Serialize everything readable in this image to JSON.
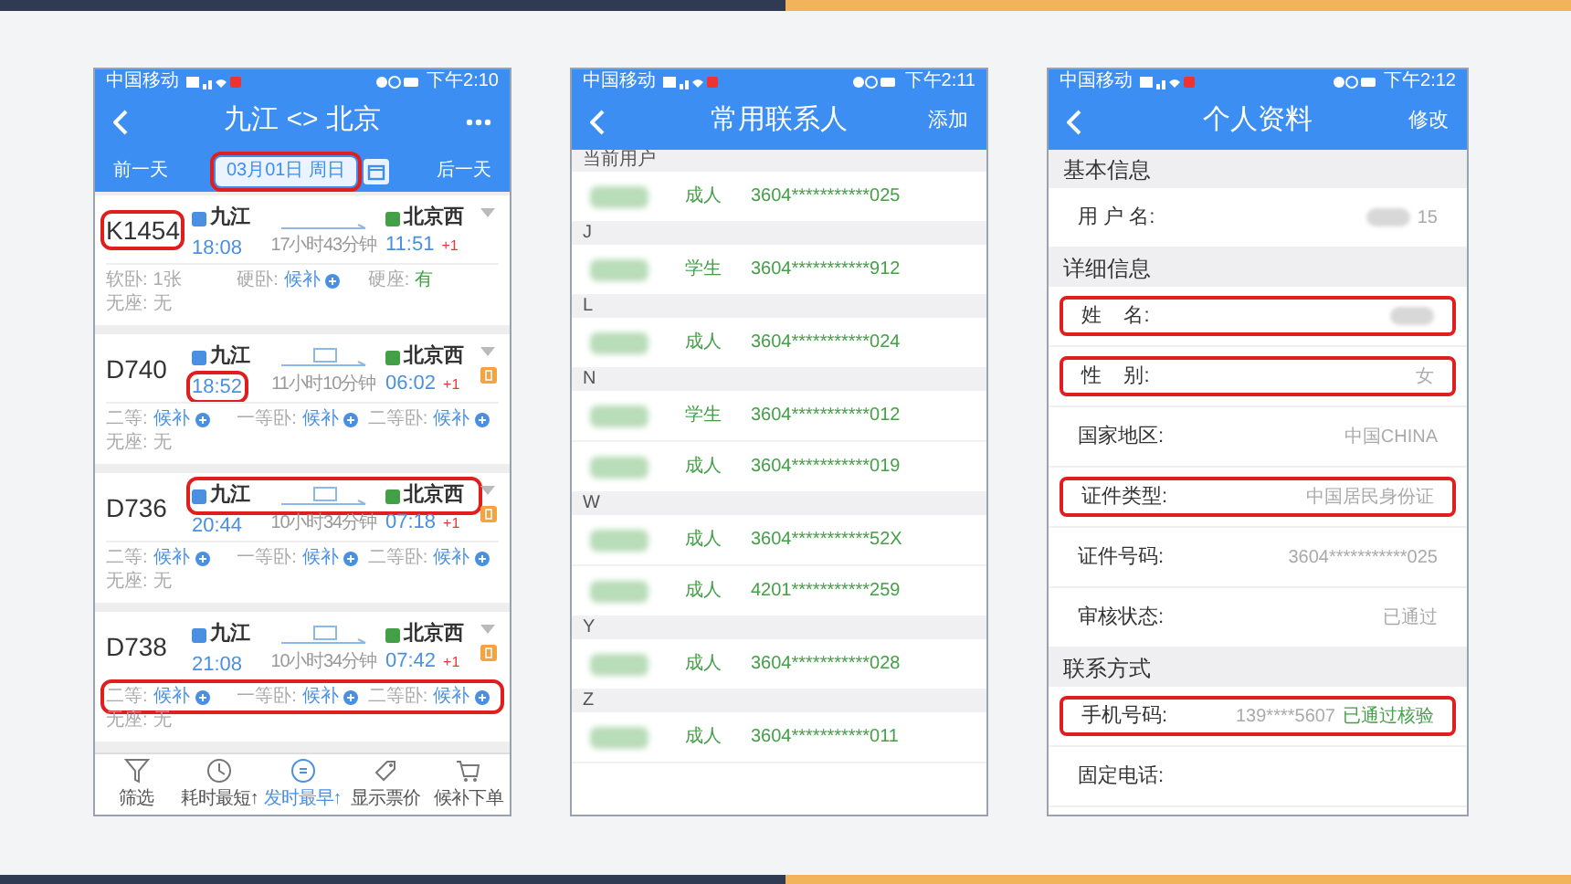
{
  "trains_screen": {
    "status": {
      "carrier": "中国移动",
      "time": "下午2:10"
    },
    "title": "九江 <> 北京",
    "prev_day": "前一天",
    "date": "03月01日 周日",
    "date_highlighted": true,
    "next_day": "后一天",
    "trains": [
      {
        "number": "K1454",
        "from": "九江",
        "depart": "18:08",
        "duration": "17小时43分钟",
        "to": "北京西",
        "arrive": "11:51",
        "arrive_mark": "+1",
        "tagged": false,
        "number_highlighted": true,
        "time_highlighted": false,
        "route_highlighted": false,
        "seats_highlighted": false,
        "seats": [
          [
            {
              "label": "软卧:",
              "value": "1张",
              "kind": "plain"
            },
            {
              "label": "硬卧:",
              "value": "候补",
              "kind": "waitlist"
            },
            {
              "label": "硬座:",
              "value": "有",
              "kind": "available"
            }
          ],
          [
            {
              "label": "无座:",
              "value": "无",
              "kind": "plain"
            }
          ]
        ]
      },
      {
        "number": "D740",
        "from": "九江",
        "depart": "18:52",
        "duration": "11小时10分钟",
        "to": "北京西",
        "arrive": "06:02",
        "arrive_mark": "+1",
        "tagged": true,
        "number_highlighted": false,
        "time_highlighted": true,
        "route_highlighted": false,
        "seats_highlighted": false,
        "seats": [
          [
            {
              "label": "二等:",
              "value": "候补",
              "kind": "waitlist"
            },
            {
              "label": "一等卧:",
              "value": "候补",
              "kind": "waitlist"
            },
            {
              "label": "二等卧:",
              "value": "候补",
              "kind": "waitlist"
            }
          ],
          [
            {
              "label": "无座:",
              "value": "无",
              "kind": "plain"
            }
          ]
        ]
      },
      {
        "number": "D736",
        "from": "九江",
        "depart": "20:44",
        "duration": "10小时34分钟",
        "to": "北京西",
        "arrive": "07:18",
        "arrive_mark": "+1",
        "tagged": true,
        "number_highlighted": false,
        "time_highlighted": false,
        "route_highlighted": true,
        "seats_highlighted": false,
        "seats": [
          [
            {
              "label": "二等:",
              "value": "候补",
              "kind": "waitlist"
            },
            {
              "label": "一等卧:",
              "value": "候补",
              "kind": "waitlist"
            },
            {
              "label": "二等卧:",
              "value": "候补",
              "kind": "waitlist"
            }
          ],
          [
            {
              "label": "无座:",
              "value": "无",
              "kind": "plain"
            }
          ]
        ]
      },
      {
        "number": "D738",
        "from": "九江",
        "depart": "21:08",
        "duration": "10小时34分钟",
        "to": "北京西",
        "arrive": "07:42",
        "arrive_mark": "+1",
        "tagged": true,
        "number_highlighted": false,
        "time_highlighted": false,
        "route_highlighted": false,
        "seats_highlighted": true,
        "seats": [
          [
            {
              "label": "二等:",
              "value": "候补",
              "kind": "waitlist"
            },
            {
              "label": "一等卧:",
              "value": "候补",
              "kind": "waitlist"
            },
            {
              "label": "二等卧:",
              "value": "候补",
              "kind": "waitlist"
            }
          ],
          [
            {
              "label": "无座:",
              "value": "无",
              "kind": "plain"
            }
          ]
        ]
      }
    ],
    "toolbar": [
      {
        "label": "筛选",
        "kind": "filter",
        "selected": false
      },
      {
        "label": "耗时最短↑",
        "kind": "duration",
        "selected": false
      },
      {
        "label": "发时最早↑",
        "kind": "departure",
        "selected": true
      },
      {
        "label": "显示票价",
        "kind": "price",
        "selected": false
      },
      {
        "label": "候补下单",
        "kind": "cart",
        "selected": false
      }
    ]
  },
  "contacts_screen": {
    "status": {
      "carrier": "中国移动",
      "time": "下午2:11"
    },
    "title": "常用联系人",
    "action": "添加",
    "groups": [
      {
        "header": "当前用户",
        "contacts": [
          {
            "type": "成人",
            "id": "3604***********025"
          }
        ]
      },
      {
        "header": "J",
        "contacts": [
          {
            "type": "学生",
            "id": "3604***********912"
          }
        ]
      },
      {
        "header": "L",
        "contacts": [
          {
            "type": "成人",
            "id": "3604***********024"
          }
        ]
      },
      {
        "header": "N",
        "contacts": [
          {
            "type": "学生",
            "id": "3604***********012"
          },
          {
            "type": "成人",
            "id": "3604***********019"
          }
        ]
      },
      {
        "header": "W",
        "contacts": [
          {
            "type": "成人",
            "id": "3604***********52X"
          },
          {
            "type": "成人",
            "id": "4201***********259"
          }
        ]
      },
      {
        "header": "Y",
        "contacts": [
          {
            "type": "成人",
            "id": "3604***********028"
          }
        ]
      },
      {
        "header": "Z",
        "contacts": [
          {
            "type": "成人",
            "id": "3604***********011"
          }
        ]
      }
    ]
  },
  "profile_screen": {
    "status": {
      "carrier": "中国移动",
      "time": "下午2:12"
    },
    "title": "个人资料",
    "action": "修改",
    "sections": [
      {
        "header": "基本信息",
        "rows": [
          {
            "label": "用 户 名:",
            "value": "15",
            "blurred": true,
            "highlighted": false
          }
        ]
      },
      {
        "header": "详细信息",
        "rows": [
          {
            "label": "姓    名:",
            "blurred": true,
            "highlighted": true
          },
          {
            "label": "性    别:",
            "value": "女",
            "blurred": false,
            "highlighted": true
          },
          {
            "label": "国家地区:",
            "value": "中国CHINA",
            "blurred": false,
            "highlighted": false
          },
          {
            "label": "证件类型:",
            "value": "中国居民身份证",
            "blurred": false,
            "highlighted": true
          },
          {
            "label": "证件号码:",
            "value": "3604***********025",
            "blurred": false,
            "highlighted": false
          },
          {
            "label": "审核状态:",
            "value": "已通过",
            "blurred": false,
            "highlighted": false
          }
        ]
      },
      {
        "header": "联系方式",
        "rows": [
          {
            "label": "手机号码:",
            "value": "139****5607",
            "badge": "已通过核验",
            "blurred": false,
            "highlighted": true
          },
          {
            "label": "固定电话:",
            "blurred": false,
            "highlighted": false
          }
        ]
      }
    ]
  }
}
